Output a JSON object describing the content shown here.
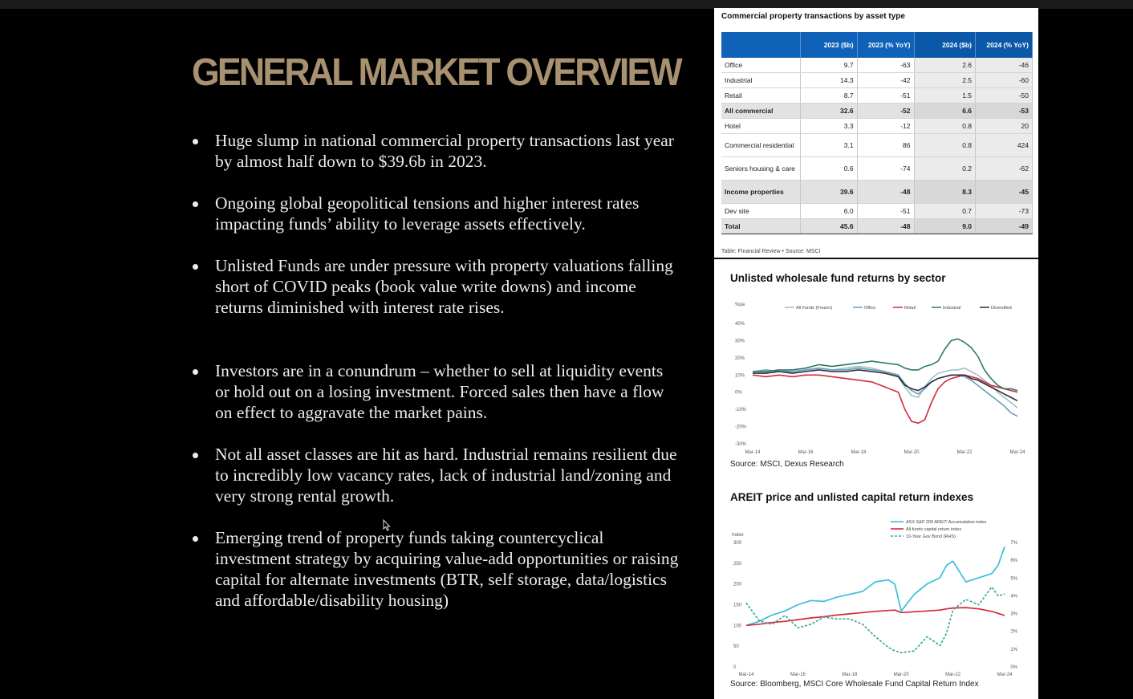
{
  "slide": {
    "title": "GENERAL MARKET OVERVIEW",
    "bullets": [
      "Huge slump in national commercial property transactions last year by almost half down to $39.6b in 2023.",
      "Ongoing global geopolitical tensions and higher interest rates impacting funds’ ability to leverage assets effectively.",
      "Unlisted Funds are under pressure with property valuations falling short of COVID peaks (book value write downs) and income returns diminished with interest rate rises.",
      "Investors are in a conundrum – whether to sell at liquidity events or hold out on a losing investment. Forced sales then have a flow on effect to aggravate the market pains.",
      "Not all asset classes are hit as hard. Industrial remains resilient due to incredibly low vacancy rates, lack of industrial land/zoning and very strong rental growth.",
      "Emerging trend of property funds taking countercyclical investment strategy by acquiring value-add opportunities or raising capital for alternate investments (BTR, self storage, data/logistics and affordable/disability housing)"
    ]
  },
  "colors": {
    "title_gold": "#a89170",
    "table_header_blue": "#0f62b8",
    "series_all_funds": "#9ec3c0",
    "series_office": "#6a9bb5",
    "series_retail": "#d42a3a",
    "series_industrial": "#2c7a6a",
    "series_diversified": "#2b2b3d",
    "areit_line": "#3bbfd8",
    "capital_line": "#d42a3a",
    "bond_line": "#3aa89a"
  },
  "table": {
    "title": "Commercial property transactions by asset type",
    "columns": [
      "",
      "2023 ($b)",
      "2023 (% YoY)",
      "2024 ($b)",
      "2024 (% YoY)"
    ],
    "rows": [
      {
        "label": "Office",
        "v2023": "9.7",
        "y2023": "-63",
        "v2024": "2.6",
        "y2024": "-46"
      },
      {
        "label": "Industrial",
        "v2023": "14.3",
        "y2023": "-42",
        "v2024": "2.5",
        "y2024": "-60"
      },
      {
        "label": "Retail",
        "v2023": "8.7",
        "y2023": "-51",
        "v2024": "1.5",
        "y2024": "-50"
      },
      {
        "label": "All commercial",
        "v2023": "32.6",
        "y2023": "-52",
        "v2024": "6.6",
        "y2024": "-53"
      },
      {
        "label": "Hotel",
        "v2023": "3.3",
        "y2023": "-12",
        "v2024": "0.8",
        "y2024": "20"
      },
      {
        "label": "Commercial residential",
        "v2023": "3.1",
        "y2023": "86",
        "v2024": "0.8",
        "y2024": "424"
      },
      {
        "label": "Seniors housing & care",
        "v2023": "0.6",
        "y2023": "-74",
        "v2024": "0.2",
        "y2024": "-62"
      },
      {
        "label": "Income properties",
        "v2023": "39.6",
        "y2023": "-48",
        "v2024": "8.3",
        "y2024": "-45"
      },
      {
        "label": "Dev site",
        "v2023": "6.0",
        "y2023": "-51",
        "v2024": "0.7",
        "y2024": "-73"
      },
      {
        "label": "Total",
        "v2023": "45.6",
        "y2023": "-48",
        "v2024": "9.0",
        "y2024": "-49"
      }
    ],
    "source": "Table: Financial Review • Source: MSCI"
  },
  "chart_data": [
    {
      "type": "line",
      "title": "Unlisted wholesale fund returns by sector",
      "ylabel": "%pa",
      "ylim": [
        -30,
        40
      ],
      "y_ticks": [
        "40%",
        "30%",
        "20%",
        "10%",
        "0%",
        "-10%",
        "-20%",
        "-30%"
      ],
      "x_ticks": [
        "Mar-14",
        "Mar-16",
        "Mar-18",
        "Mar-20",
        "Mar-22",
        "Mar-24"
      ],
      "x": [
        2014.25,
        2014.75,
        2015.25,
        2015.75,
        2016.25,
        2016.75,
        2017.25,
        2017.75,
        2018.25,
        2018.75,
        2019.25,
        2019.75,
        2020.0,
        2020.25,
        2020.5,
        2020.75,
        2021.0,
        2021.25,
        2021.5,
        2021.75,
        2022.0,
        2022.25,
        2022.5,
        2022.75,
        2023.0,
        2023.25,
        2023.5,
        2023.75,
        2024.0,
        2024.25
      ],
      "series": [
        {
          "name": "All Funds (Frozen)",
          "values": [
            12,
            12,
            13,
            12,
            13,
            14,
            13,
            14,
            15,
            14,
            12,
            9,
            3,
            -2,
            -3,
            3,
            8,
            11,
            12,
            13,
            13,
            14,
            12,
            10,
            7,
            4,
            0,
            -3,
            -6,
            -9
          ]
        },
        {
          "name": "Office",
          "values": [
            12,
            13,
            12,
            12,
            13,
            14,
            13,
            13,
            14,
            13,
            12,
            10,
            5,
            1,
            -1,
            2,
            6,
            8,
            9,
            10,
            10,
            9,
            7,
            4,
            1,
            -2,
            -5,
            -8,
            -12,
            -14
          ]
        },
        {
          "name": "Retail",
          "values": [
            10,
            9,
            10,
            9,
            10,
            10,
            9,
            8,
            7,
            6,
            3,
            0,
            -10,
            -17,
            -18,
            -16,
            -6,
            2,
            6,
            8,
            9,
            10,
            9,
            8,
            6,
            4,
            3,
            2,
            1,
            0
          ]
        },
        {
          "name": "Industrial",
          "values": [
            12,
            12,
            13,
            13,
            14,
            16,
            15,
            16,
            17,
            18,
            17,
            16,
            14,
            13,
            13,
            15,
            16,
            18,
            25,
            30,
            31,
            29,
            26,
            21,
            13,
            8,
            4,
            2,
            2,
            1
          ]
        },
        {
          "name": "Diversified",
          "values": [
            11,
            11,
            12,
            11,
            12,
            13,
            12,
            12,
            13,
            12,
            11,
            9,
            4,
            2,
            1,
            3,
            6,
            8,
            9,
            10,
            10,
            10,
            8,
            7,
            5,
            3,
            1,
            -1,
            -3,
            -5
          ]
        }
      ]
    },
    {
      "type": "line",
      "title": "AREIT price and unlisted capital return indexes",
      "ylabel": "Index",
      "ylim": [
        0,
        300
      ],
      "y_ticks": [
        "300",
        "250",
        "200",
        "150",
        "100",
        "50",
        "0"
      ],
      "ylim_right": [
        0,
        7
      ],
      "y_ticks_right": [
        "7%",
        "6%",
        "5%",
        "4%",
        "3%",
        "2%",
        "1%",
        "0%"
      ],
      "x_ticks": [
        "Mar-14",
        "Mar-16",
        "Mar-18",
        "Mar-20",
        "Mar-22",
        "Mar-24"
      ],
      "x": [
        2014.25,
        2014.75,
        2015.25,
        2015.75,
        2016.25,
        2016.75,
        2017.25,
        2017.75,
        2018.25,
        2018.75,
        2019.25,
        2019.75,
        2020.0,
        2020.25,
        2020.75,
        2021.25,
        2021.75,
        2022.0,
        2022.25,
        2022.75,
        2023.25,
        2023.75,
        2024.0,
        2024.25
      ],
      "series": [
        {
          "name": "ASX S&P 200 AREIT Accumulation index",
          "values": [
            100,
            110,
            125,
            135,
            150,
            160,
            158,
            168,
            175,
            182,
            205,
            210,
            200,
            135,
            175,
            200,
            215,
            245,
            255,
            205,
            215,
            225,
            245,
            290
          ]
        },
        {
          "name": "All funds capital return index",
          "values": [
            100,
            103,
            107,
            110,
            114,
            118,
            121,
            125,
            128,
            131,
            134,
            136,
            137,
            131,
            133,
            135,
            137,
            140,
            142,
            143,
            140,
            134,
            129,
            124
          ]
        },
        {
          "name": "10-Year Gov Bond (RHS)",
          "values": [
            3.6,
            2.6,
            2.4,
            2.9,
            2.2,
            2.4,
            2.8,
            2.7,
            2.7,
            2.4,
            1.7,
            1.1,
            0.9,
            0.8,
            0.9,
            1.7,
            1.2,
            1.9,
            3.2,
            3.8,
            3.5,
            4.5,
            4.0,
            4.1
          ]
        }
      ],
      "axis": "series 3 plotted against the right-hand axis"
    }
  ],
  "charts": {
    "returns_source": "Source: MSCI, Dexus Research",
    "areit_source": "Source: Bloomberg, MSCI Core Wholesale Fund Capital Return Index"
  }
}
